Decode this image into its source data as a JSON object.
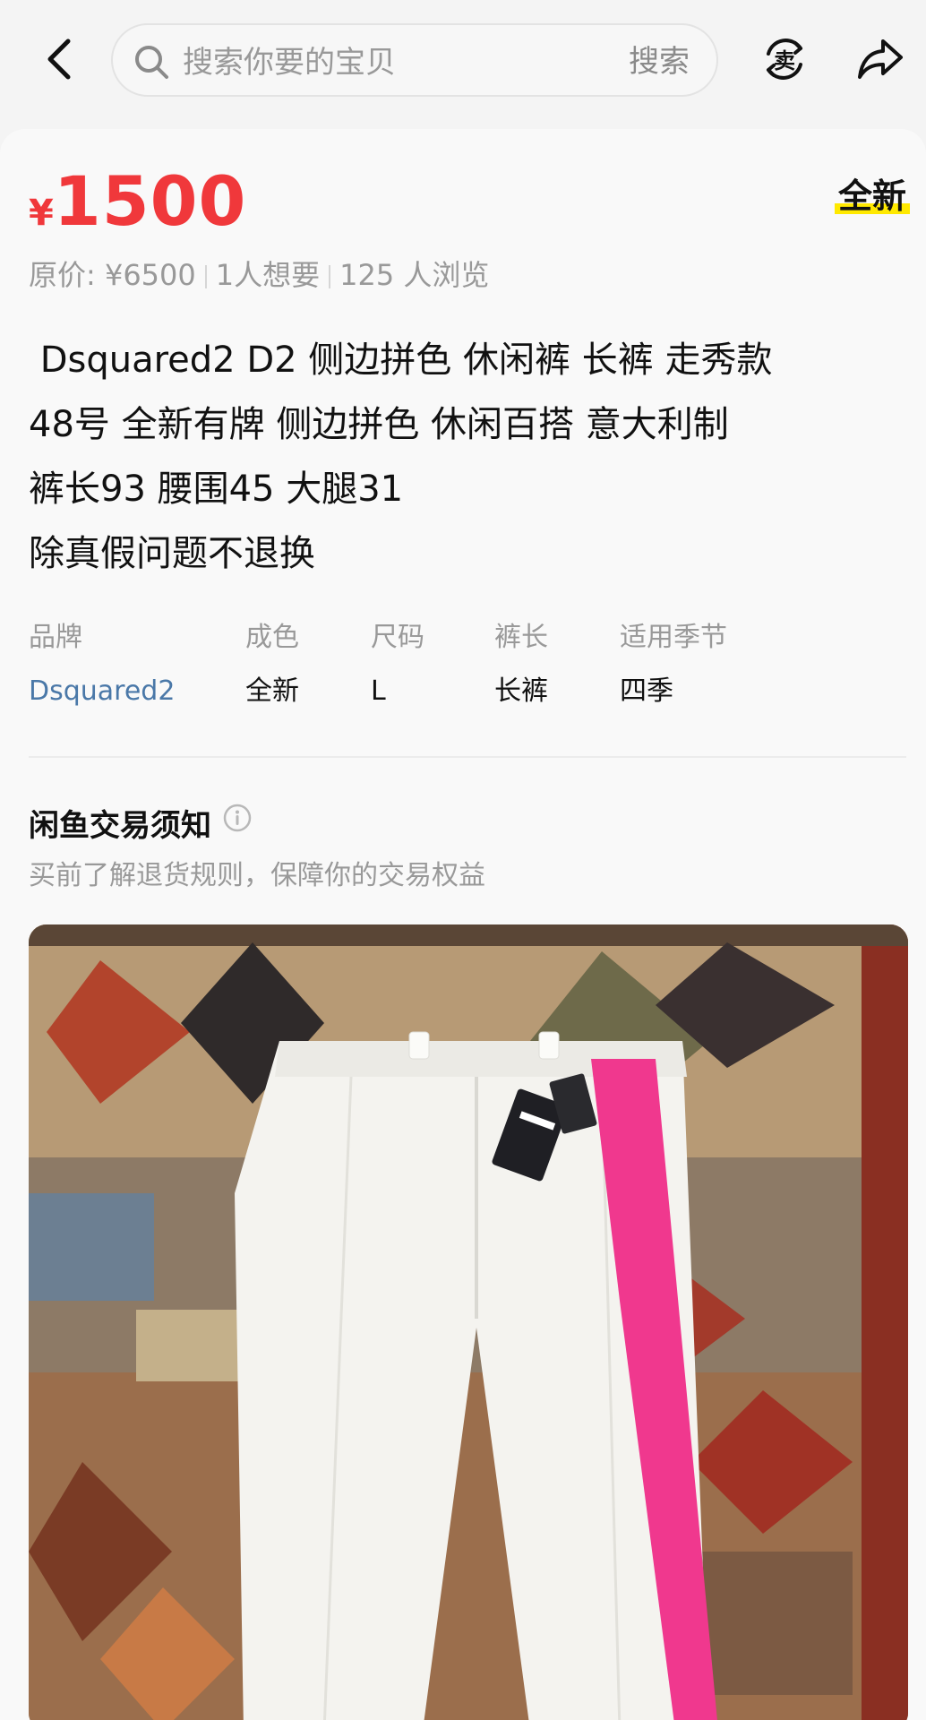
{
  "topbar": {
    "search_placeholder": "搜索你要的宝贝",
    "search_button": "搜索",
    "sell_label": "卖"
  },
  "product": {
    "currency": "¥",
    "price": "1500",
    "condition_badge": "全新",
    "meta": {
      "original_price": "原价: ¥6500",
      "wants": "1人想要",
      "views": "125 人浏览"
    },
    "description": [
      " Dsquared2 D2 侧边拼色 休闲裤 长裤 走秀款",
      "48号 全新有牌 侧边拼色 休闲百搭 意大利制",
      "裤长93 腰围45 大腿31",
      "除真假问题不退换"
    ],
    "specs": [
      {
        "key": "品牌",
        "value": "Dsquared2"
      },
      {
        "key": "成色",
        "value": "全新"
      },
      {
        "key": "尺码",
        "value": "L"
      },
      {
        "key": "裤长",
        "value": "长裤"
      },
      {
        "key": "适用季节",
        "value": "四季"
      }
    ]
  },
  "notice": {
    "title": "闲鱼交易须知",
    "subtitle": "买前了解退货规则，保障你的交易权益"
  },
  "colors": {
    "price": "#f0383b",
    "badge_highlight": "#ffe900",
    "link": "#4a78a8",
    "stripe": "#f0388e"
  }
}
